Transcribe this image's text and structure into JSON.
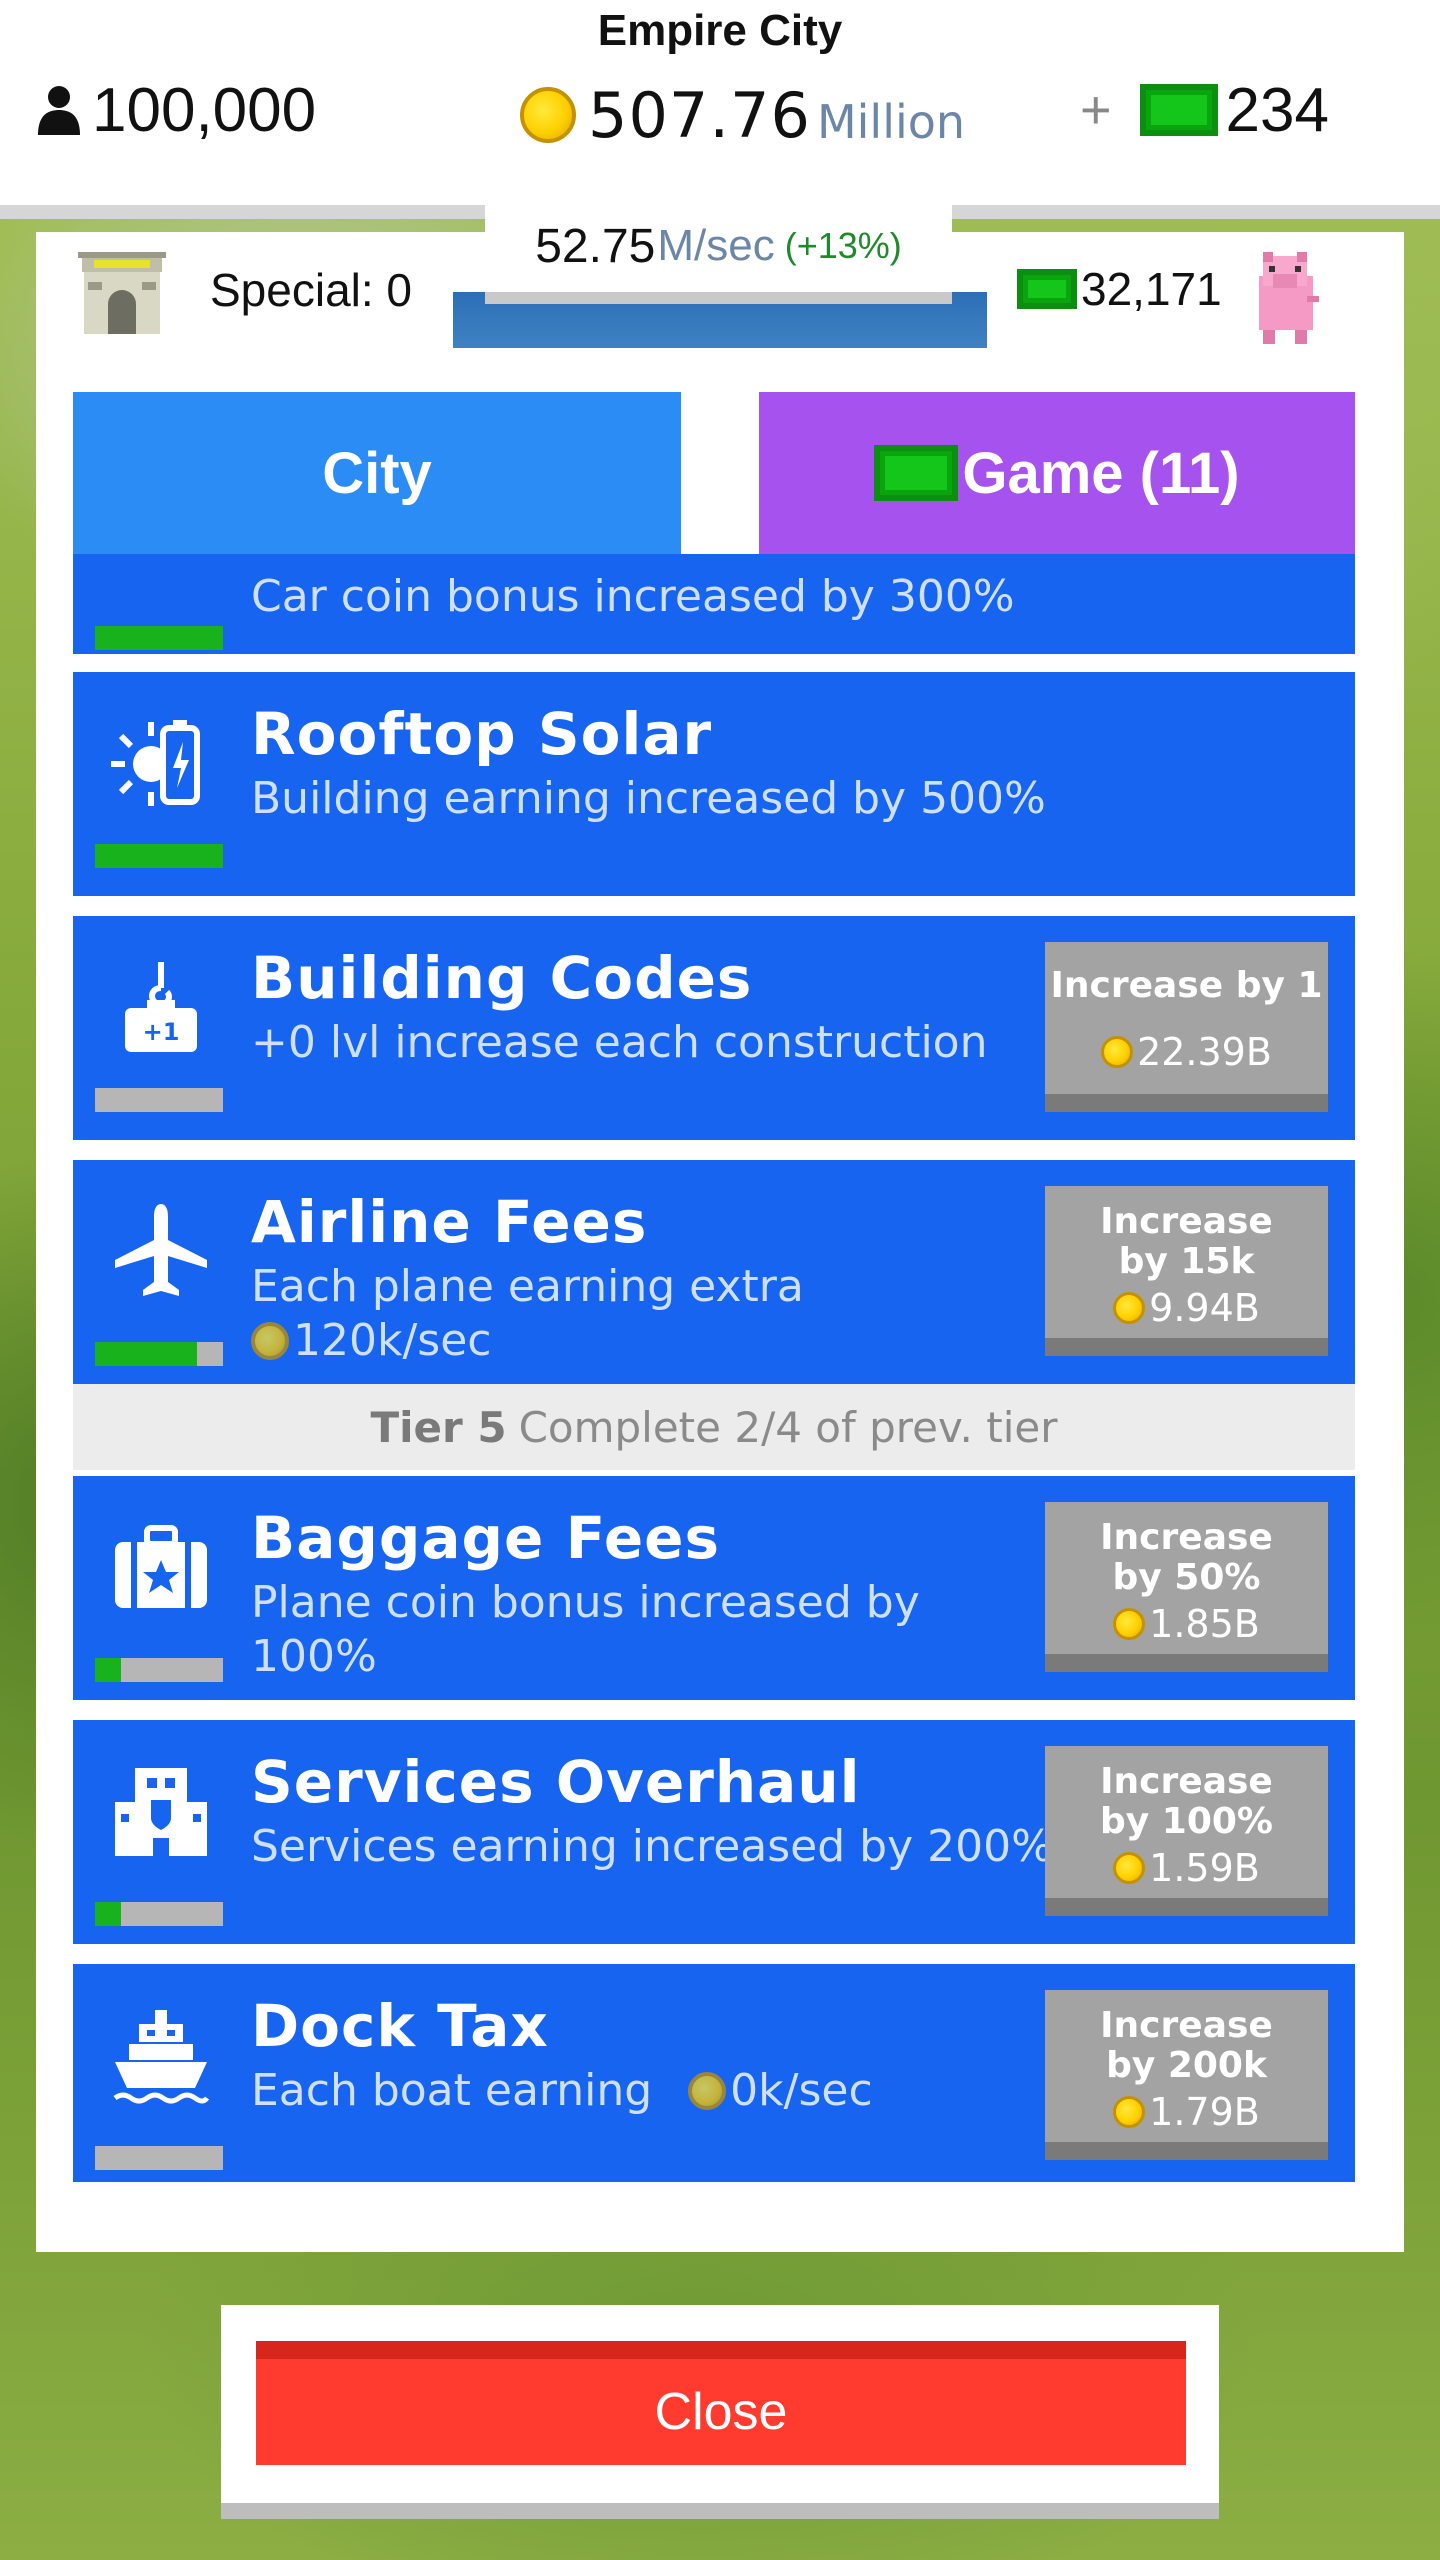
{
  "header": {
    "city_name": "Empire City",
    "population": "100,000",
    "coins_value": "507.76",
    "coins_unit": "Million",
    "add_symbol": "+",
    "cash": "234",
    "rate_value": "52.75",
    "rate_unit": "M/sec",
    "rate_bonus": "(+13%)"
  },
  "panel": {
    "special_label": "Special: 0",
    "cash_balance": "32,171"
  },
  "tabs": {
    "city": "City",
    "game": "Game (11)"
  },
  "upgrades": [
    {
      "title": "",
      "desc": "Car coin bonus increased by 300%",
      "progress": 1.0
    },
    {
      "title": "Rooftop Solar",
      "desc": "Building earning increased by 500%",
      "progress": 1.0
    },
    {
      "title": "Building Codes",
      "desc": "+0 lvl increase each construction",
      "progress": 0.0,
      "button_label": "Increase by 1",
      "cost": "22.39B"
    },
    {
      "title": "Airline Fees",
      "desc": "Each plane earning extra",
      "desc2": "120k/sec",
      "progress": 0.8,
      "button_label": "Increase by 15k",
      "cost": "9.94B"
    },
    {
      "title": "Baggage Fees",
      "desc": "Plane coin bonus increased by 100%",
      "progress": 0.2,
      "button_label": "Increase by 50%",
      "cost": "1.85B"
    },
    {
      "title": "Services Overhaul",
      "desc": "Services earning increased by 200%",
      "progress": 0.2,
      "button_label": "Increase by 100%",
      "cost": "1.59B"
    },
    {
      "title": "Dock Tax",
      "desc": "Each boat earning",
      "desc2": "0k/sec",
      "progress": 0.0,
      "button_label": "Increase by 200k",
      "cost": "1.79B"
    }
  ],
  "tier": {
    "label": "Tier 5",
    "text": "Complete 2/4 of prev. tier"
  },
  "close_label": "Close",
  "icons": [
    "person-icon",
    "coin-icon",
    "cash-icon",
    "arch-icon",
    "piggy-bank-icon",
    "solar-battery-icon",
    "hook-toolbox-icon",
    "airplane-icon",
    "suitcase-icon",
    "building-icon",
    "ship-icon"
  ],
  "colors": {
    "card_blue": "#1764f1",
    "tab_city": "#2b8cf5",
    "tab_game": "#a652ee",
    "close_red": "#ff3b30",
    "progress_green": "#18b21c"
  }
}
